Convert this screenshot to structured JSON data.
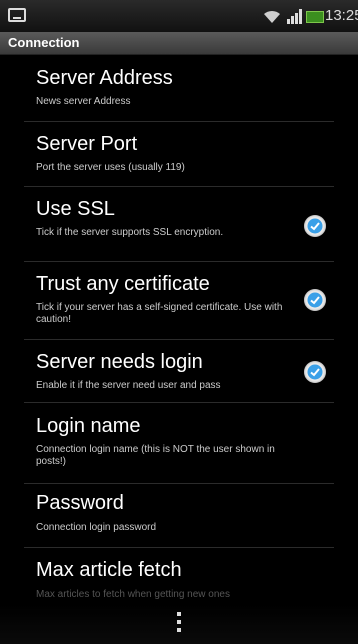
{
  "status_bar": {
    "time": "13:25",
    "icons": [
      "sd-card-icon",
      "wifi-icon",
      "signal-icon",
      "battery-icon"
    ]
  },
  "header": {
    "title": "Connection"
  },
  "settings": [
    {
      "title": "Server Address",
      "summary": "News server Address"
    },
    {
      "title": "Server Port",
      "summary": "Port the server uses (usually 119)"
    },
    {
      "title": "Use SSL",
      "summary": "Tick if the server supports SSL encryption.",
      "checked": true
    },
    {
      "title": "Trust any certificate",
      "summary": "Tick if your server has a self-signed certificate. Use with caution!",
      "checked": true
    },
    {
      "title": "Server needs login",
      "summary": "Enable it if the server need user and pass",
      "checked": true
    },
    {
      "title": "Login name",
      "summary": "Connection login name (this is NOT the user shown in posts!)"
    },
    {
      "title": "Password",
      "summary": "Connection login password"
    },
    {
      "title": "Max article fetch",
      "summary": "Max articles to fetch when getting new ones"
    }
  ],
  "colors": {
    "check_accent": "#3aa0e8",
    "background": "#000000"
  }
}
